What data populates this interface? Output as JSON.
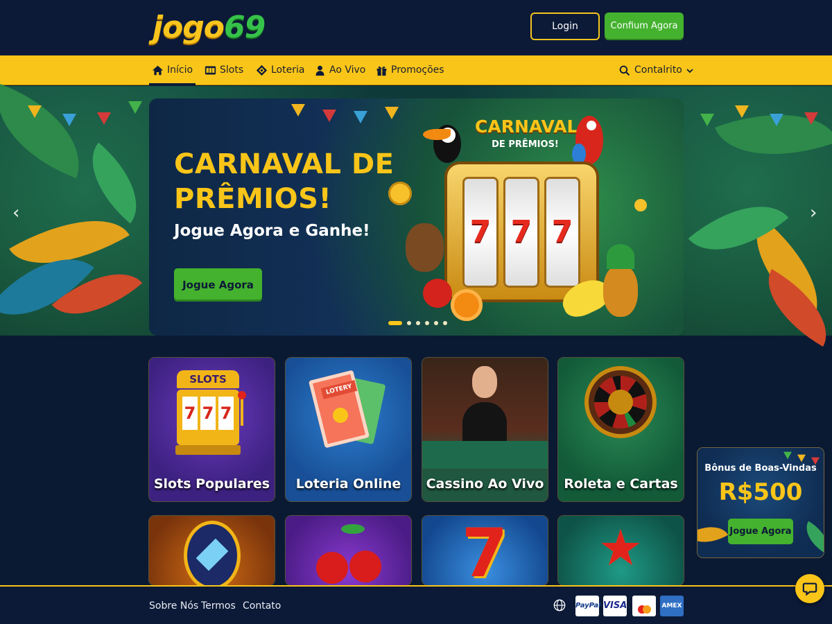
{
  "brand": {
    "logo_part1": "jogo",
    "logo_part2": "69"
  },
  "header": {
    "login_label": "Login",
    "signup_label": "Confium Agora"
  },
  "nav": {
    "items": [
      {
        "label": "Início",
        "icon": "home-icon",
        "active": true
      },
      {
        "label": "Slots",
        "icon": "slot-machine-icon",
        "active": false
      },
      {
        "label": "Loteria",
        "icon": "ticket-icon",
        "active": false
      },
      {
        "label": "Ao Vivo",
        "icon": "dealer-icon",
        "active": false
      },
      {
        "label": "Promoções",
        "icon": "gift-icon",
        "active": false
      }
    ],
    "search_label": "Contalrito"
  },
  "hero": {
    "title": "CARNAVAL DE PRÊMIOS!",
    "subtitle": "Jogue Agora e Ganhe!",
    "cta_label": "Jogue Agora",
    "art_title_line1": "CARNAVAL",
    "art_title_line2": "DE PRÊMIOS!",
    "slide_count": 6,
    "active_slide": 1
  },
  "cards": [
    {
      "label": "Slots Populares",
      "bg": "#4a2a8c"
    },
    {
      "label": "Loteria Online",
      "bg": "#1f5ca8"
    },
    {
      "label": "Cassino Ao Vivo",
      "bg": "#3b2a1e"
    },
    {
      "label": "Roleta e Cartas",
      "bg": "#1a6a43"
    }
  ],
  "bonus": {
    "title": "Bônus de Boas-Vindas",
    "amount": "R$500",
    "cta_label": "Jogue Agora"
  },
  "footer": {
    "links": [
      "Sobre Nós",
      "Termos",
      "Contato"
    ],
    "payments": [
      "PayPal",
      "VISA",
      "Mastercard",
      "AMEX"
    ]
  },
  "colors": {
    "accent_yellow": "#f9c519",
    "accent_green": "#44b22e",
    "navy": "#0c1a37"
  }
}
